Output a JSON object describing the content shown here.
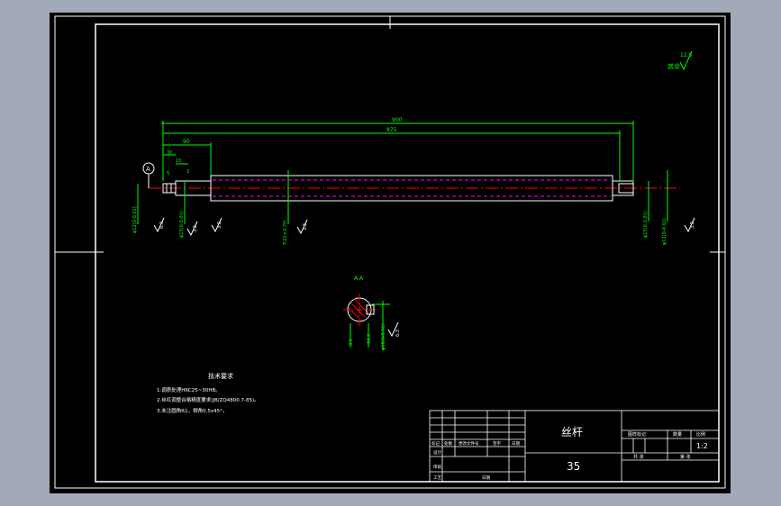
{
  "colors": {
    "background": "#a2a9b8",
    "canvas": "#000000",
    "outline": "#ffffff",
    "dimension": "#00ff00",
    "centerline": "#ff0000",
    "hidden": "#ff00ff"
  },
  "roughness_note": {
    "label": "其余",
    "value": "12.5"
  },
  "dimensions": {
    "overall_length": "900",
    "thread_length": "875",
    "step_90": "90",
    "step_30": "30",
    "step_15": "15",
    "step_5": "5",
    "step_3": "3"
  },
  "datum": {
    "label": "A"
  },
  "section": {
    "label": "A-A",
    "dim_a": "3.5",
    "dim_b": "10.2",
    "tol": "6.3"
  },
  "vertical_dims": {
    "d1": "φ12(0-0.01)",
    "d2": "φ15(0-0.01)",
    "d3": "Tr22×3-7H",
    "d4": "φ15(0-0.01)",
    "d5": "φ12(0-0.01)",
    "sec": "φ10(0-0.01)",
    "ra1": "6.3",
    "ra2": "3.2",
    "ra3": "3.2",
    "ra4": "3.2",
    "ra5": "3.2"
  },
  "tech_req": {
    "title": "技术要求",
    "items": [
      "1.调质处理HRC25~30HB。",
      "2.丝杠调整合格精度要求(JB/ZQ4800.7-85)。",
      "3.未注圆角R1，倒角0.5x45°。"
    ]
  },
  "title_block": {
    "part_name": "丝杆",
    "material": "35",
    "scale": "1:2",
    "header_cells": [
      "图样标记",
      "数量",
      "比例"
    ],
    "sign_cells": [
      "标记",
      "处数",
      "更改文件号",
      "签字",
      "日期"
    ],
    "role_cells": [
      "设计",
      "审核",
      "工艺"
    ],
    "sheet_cells": [
      "共  张",
      "第  张"
    ],
    "date_cell": "日期"
  }
}
